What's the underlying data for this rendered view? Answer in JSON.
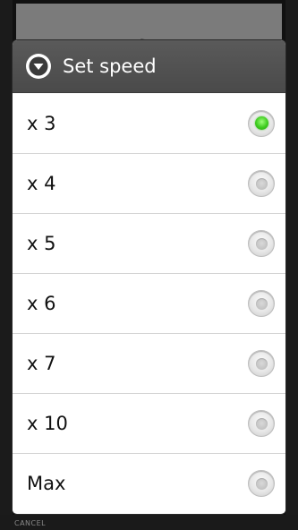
{
  "background": {
    "cancel_label": "CANCEL"
  },
  "dialog": {
    "title": "Set speed",
    "title_icon": "chevron-down-circle-icon",
    "options": [
      {
        "label": "x 3",
        "selected": true
      },
      {
        "label": "x 4",
        "selected": false
      },
      {
        "label": "x 5",
        "selected": false
      },
      {
        "label": "x 6",
        "selected": false
      },
      {
        "label": "x 7",
        "selected": false
      },
      {
        "label": "x 10",
        "selected": false
      },
      {
        "label": "Max",
        "selected": false
      }
    ]
  },
  "colors": {
    "header": "#4f4f4f",
    "selected_radio": "#3ecb1f",
    "divider": "#d4d4d4"
  }
}
